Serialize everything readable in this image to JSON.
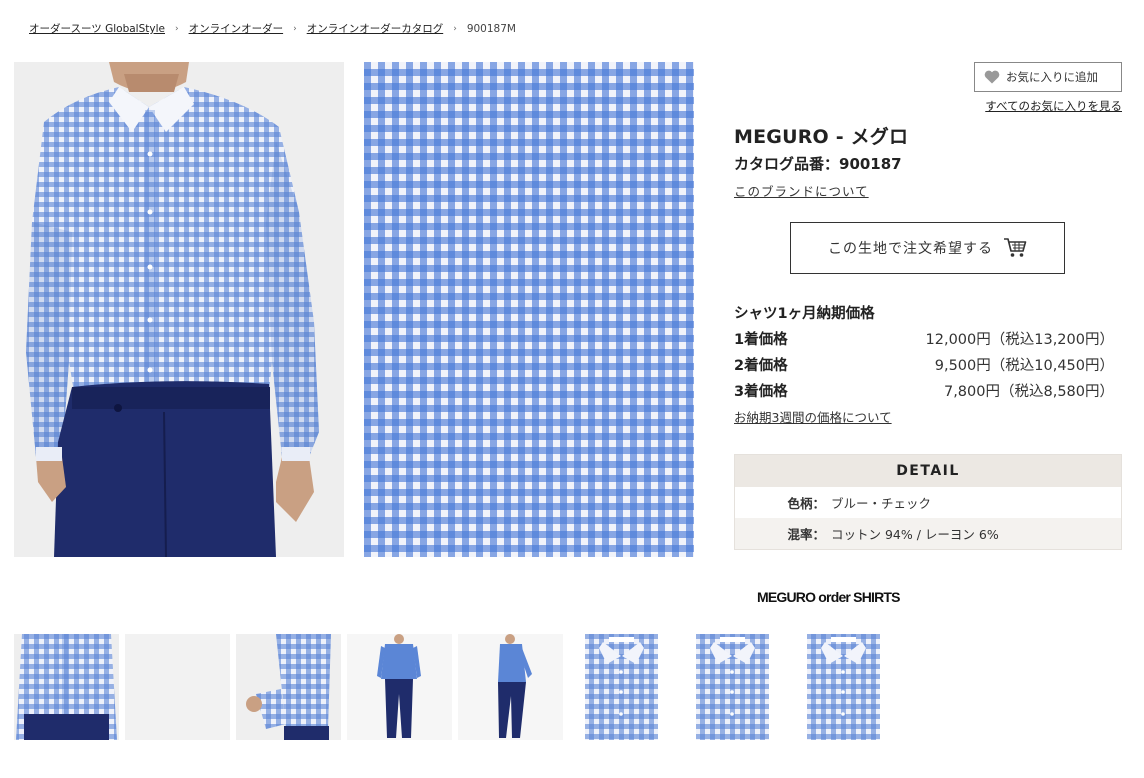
{
  "breadcrumb": {
    "items": [
      "オーダースーツ GlobalStyle",
      "オンラインオーダー",
      "オンラインオーダーカタログ"
    ],
    "current": "900187M",
    "separator": "›"
  },
  "favorites": {
    "add_label": "お気に入りに追加",
    "view_all_label": "すべてのお気に入りを見る"
  },
  "product": {
    "title": "MEGURO - メグロ",
    "catalog_number": "カタログ品番：900187",
    "brand_link": "このブランドについて",
    "order_button": "この生地で注文希望する"
  },
  "pricing": {
    "heading": "シャツ1ヶ月納期価格",
    "rows": [
      {
        "label": "1着価格",
        "value": "12,000円（税込13,200円）"
      },
      {
        "label": "2着価格",
        "value": "9,500円（税込10,450円）"
      },
      {
        "label": "3着価格",
        "value": "7,800円（税込8,580円）"
      }
    ],
    "note_link": "お納期3週間の価格について"
  },
  "detail": {
    "heading": "DETAIL",
    "rows": [
      {
        "key": "色柄：",
        "value": "ブルー・チェック"
      },
      {
        "key": "混率：",
        "value": "コットン 94% / レーヨン 6%"
      }
    ]
  },
  "brand_logo": "MEGURO order SHIRTS",
  "colors": {
    "shirt_blue": "#5b86d6",
    "trouser_navy": "#1f2c6b",
    "detail_header_bg": "#ece8e3"
  },
  "icons": {
    "favorite": "heart-icon",
    "cart": "cart-icon"
  }
}
